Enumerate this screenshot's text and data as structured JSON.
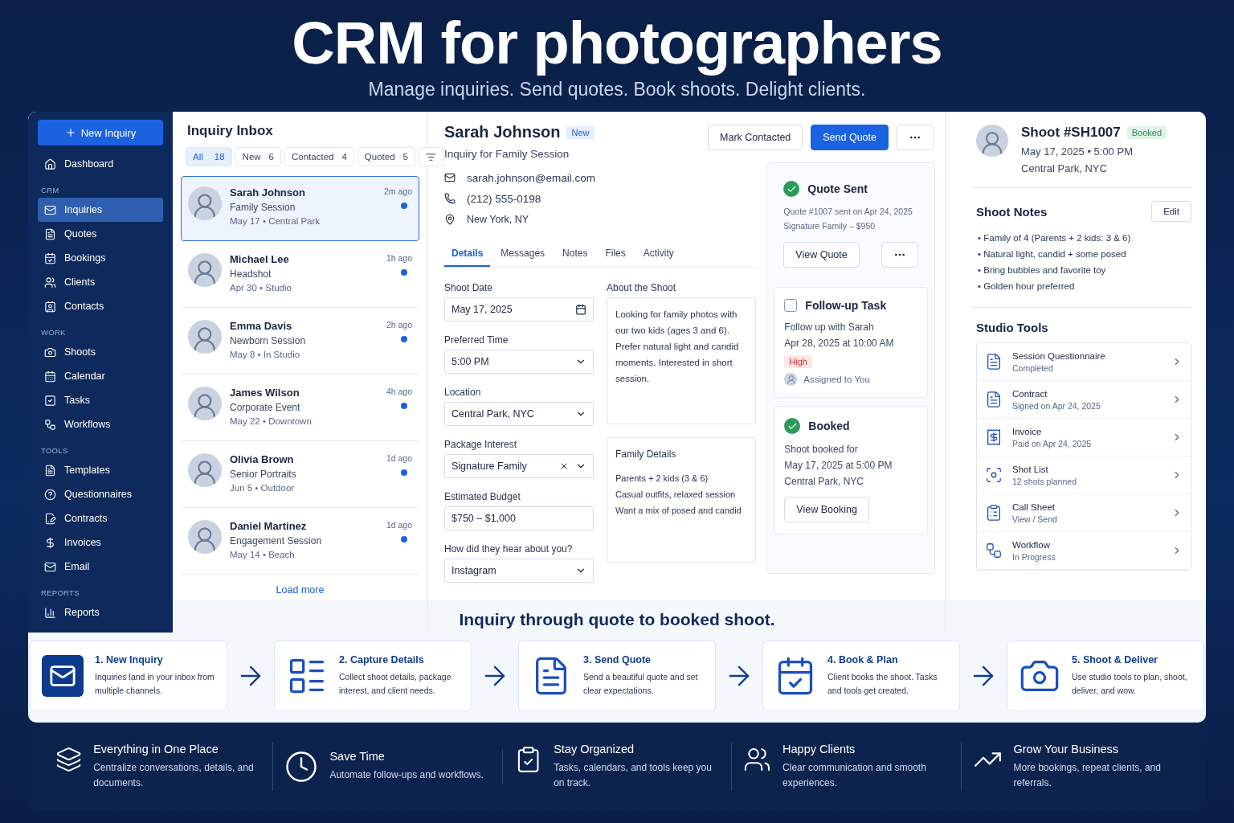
{
  "header": {
    "title": "CRM for photographers",
    "subtitle": "Manage inquiries. Send quotes. Book shoots. Delight clients."
  },
  "sidebar": {
    "new_button": "New Inquiry",
    "sections": [
      {
        "items": [
          {
            "label": "Dashboard",
            "selected": false
          }
        ]
      },
      {
        "heading": "CRM",
        "items": [
          {
            "label": "Inquiries",
            "selected": true
          },
          {
            "label": "Quotes",
            "selected": false
          },
          {
            "label": "Bookings",
            "selected": false
          },
          {
            "label": "Clients",
            "selected": false
          },
          {
            "label": "Contacts",
            "selected": false
          }
        ]
      },
      {
        "heading": "WORK",
        "items": [
          {
            "label": "Shoots",
            "selected": false
          },
          {
            "label": "Calendar",
            "selected": false
          },
          {
            "label": "Tasks",
            "selected": false
          },
          {
            "label": "Workflows",
            "selected": false
          }
        ]
      },
      {
        "heading": "TOOLS",
        "items": [
          {
            "label": "Templates",
            "selected": false
          },
          {
            "label": "Questionnaires",
            "selected": false
          },
          {
            "label": "Contracts",
            "selected": false
          },
          {
            "label": "Invoices",
            "selected": false
          },
          {
            "label": "Email",
            "selected": false
          }
        ]
      },
      {
        "heading": "REPORTS",
        "items": [
          {
            "label": "Reports",
            "selected": false
          }
        ]
      }
    ]
  },
  "inbox": {
    "title": "Inquiry Inbox",
    "filters": [
      {
        "label": "All",
        "count": "18",
        "selected": true
      },
      {
        "label": "New",
        "count": "6",
        "selected": false
      },
      {
        "label": "Contacted",
        "count": "4",
        "selected": false
      },
      {
        "label": "Quoted",
        "count": "5",
        "selected": false
      }
    ],
    "inquiries": [
      {
        "name": "Sarah Johnson",
        "session": "Family Session",
        "meta": "May 17 • Central Park",
        "time": "2m ago",
        "unread": true,
        "selected": true
      },
      {
        "name": "Michael Lee",
        "session": "Headshot",
        "meta": "Apr 30 • Studio",
        "time": "1h ago",
        "unread": true,
        "selected": false
      },
      {
        "name": "Emma Davis",
        "session": "Newborn Session",
        "meta": "May 8 • In Studio",
        "time": "2h ago",
        "unread": true,
        "selected": false
      },
      {
        "name": "James Wilson",
        "session": "Corporate Event",
        "meta": "May 22 • Downtown",
        "time": "4h ago",
        "unread": true,
        "selected": false
      },
      {
        "name": "Olivia Brown",
        "session": "Senior Portraits",
        "meta": "Jun 5 • Outdoor",
        "time": "1d ago",
        "unread": true,
        "selected": false
      },
      {
        "name": "Daniel Martinez",
        "session": "Engagement Session",
        "meta": "May 14 • Beach",
        "time": "1d ago",
        "unread": true,
        "selected": false
      }
    ],
    "load_more": "Load more"
  },
  "detail": {
    "name": "Sarah Johnson",
    "badge": "New",
    "subtitle": "Inquiry for Family Session",
    "actions": [
      {
        "label": "Mark Contacted",
        "primary": false
      },
      {
        "label": "Send Quote",
        "primary": true
      }
    ],
    "email": "sarah.johnson@email.com",
    "phone": "(212) 555-0198",
    "location": "New York, NY",
    "tabs": [
      {
        "label": "Details",
        "selected": true
      },
      {
        "label": "Messages",
        "selected": false
      },
      {
        "label": "Notes",
        "selected": false
      },
      {
        "label": "Files",
        "selected": false
      },
      {
        "label": "Activity",
        "selected": false
      }
    ],
    "fields": [
      {
        "label": "Shoot Date",
        "value": "May 17, 2025",
        "kind": "date"
      },
      {
        "label": "Preferred Time",
        "value": "5:00 PM",
        "kind": "select"
      },
      {
        "label": "Location",
        "value": "Central Park, NYC",
        "kind": "select"
      },
      {
        "label": "Package Interest",
        "value": "Signature Family",
        "kind": "clearable"
      },
      {
        "label": "Estimated Budget",
        "value": "$750 – $1,000",
        "kind": "text"
      },
      {
        "label": "How did they hear about you?",
        "value": "Instagram",
        "kind": "select"
      }
    ],
    "about": {
      "title": "About the Shoot",
      "text": "Looking for family photos with our two kids (ages 3 and 6). Prefer natural light and candid moments. Interested in short session."
    },
    "family": {
      "title": "Family Details",
      "lines": [
        "Parents + 2 kids (3 & 6)",
        "Casual outfits, relaxed session",
        "Want a mix of posed and candid"
      ]
    },
    "quote": {
      "title": "Quote Sent",
      "lines": [
        "Quote #1007 sent on Apr 24, 2025",
        "Signature Family – $950"
      ],
      "button": "View Quote"
    },
    "task": {
      "title": "Follow-up Task",
      "checked": false,
      "lines": [
        "Follow up with Sarah",
        "Apr 28, 2025 at 10:00 AM"
      ],
      "priority": "High",
      "assignee": "Assigned to You"
    },
    "booked": {
      "title": "Booked",
      "lines": [
        "Shoot booked for",
        "May 17, 2025 at 5:00 PM",
        "Central Park, NYC"
      ],
      "button": "View Booking"
    }
  },
  "shoot": {
    "title": "Shoot #SH1007",
    "badge": "Booked",
    "date": "May 17, 2025 • 5:00 PM",
    "location": "Central Park, NYC"
  },
  "notes": {
    "title": "Shoot Notes",
    "edit": "Edit",
    "items": [
      "• Family of 4 (Parents + 2 kids: 3 & 6)",
      "• Natural light, candid + some posed",
      "• Bring bubbles and favorite toy",
      "• Golden hour preferred"
    ]
  },
  "tools": {
    "title": "Studio Tools",
    "items": [
      {
        "name": "Session Questionnaire",
        "status": "Completed"
      },
      {
        "name": "Contract",
        "status": "Signed on Apr 24, 2025"
      },
      {
        "name": "Invoice",
        "status": "Paid on Apr 24, 2025"
      },
      {
        "name": "Shot List",
        "status": "12 shots planned"
      },
      {
        "name": "Call Sheet",
        "status": "View / Send"
      },
      {
        "name": "Workflow",
        "status": "In Progress"
      }
    ]
  },
  "workflow": {
    "title": "Inquiry through quote to booked shoot.",
    "steps": [
      {
        "title": "1. New Inquiry",
        "text": "Inquiries land in your inbox from multiple channels."
      },
      {
        "title": "2. Capture Details",
        "text": "Collect shoot details, package interest, and client needs."
      },
      {
        "title": "3. Send Quote",
        "text": "Send a beautiful quote and set clear expectations."
      },
      {
        "title": "4. Book & Plan",
        "text": "Client books the shoot. Tasks and tools get created."
      },
      {
        "title": "5. Shoot & Deliver",
        "text": "Use studio tools to plan, shoot, deliver, and wow."
      }
    ]
  },
  "features": [
    {
      "title": "Everything in One Place",
      "text": "Centralize conversations, details, and documents."
    },
    {
      "title": "Save Time",
      "text": "Automate follow-ups and workflows."
    },
    {
      "title": "Stay Organized",
      "text": "Tasks, calendars, and tools keep you on track."
    },
    {
      "title": "Happy Clients",
      "text": "Clear communication and smooth experiences."
    },
    {
      "title": "Grow Your Business",
      "text": "More bookings, repeat clients, and referrals."
    }
  ]
}
